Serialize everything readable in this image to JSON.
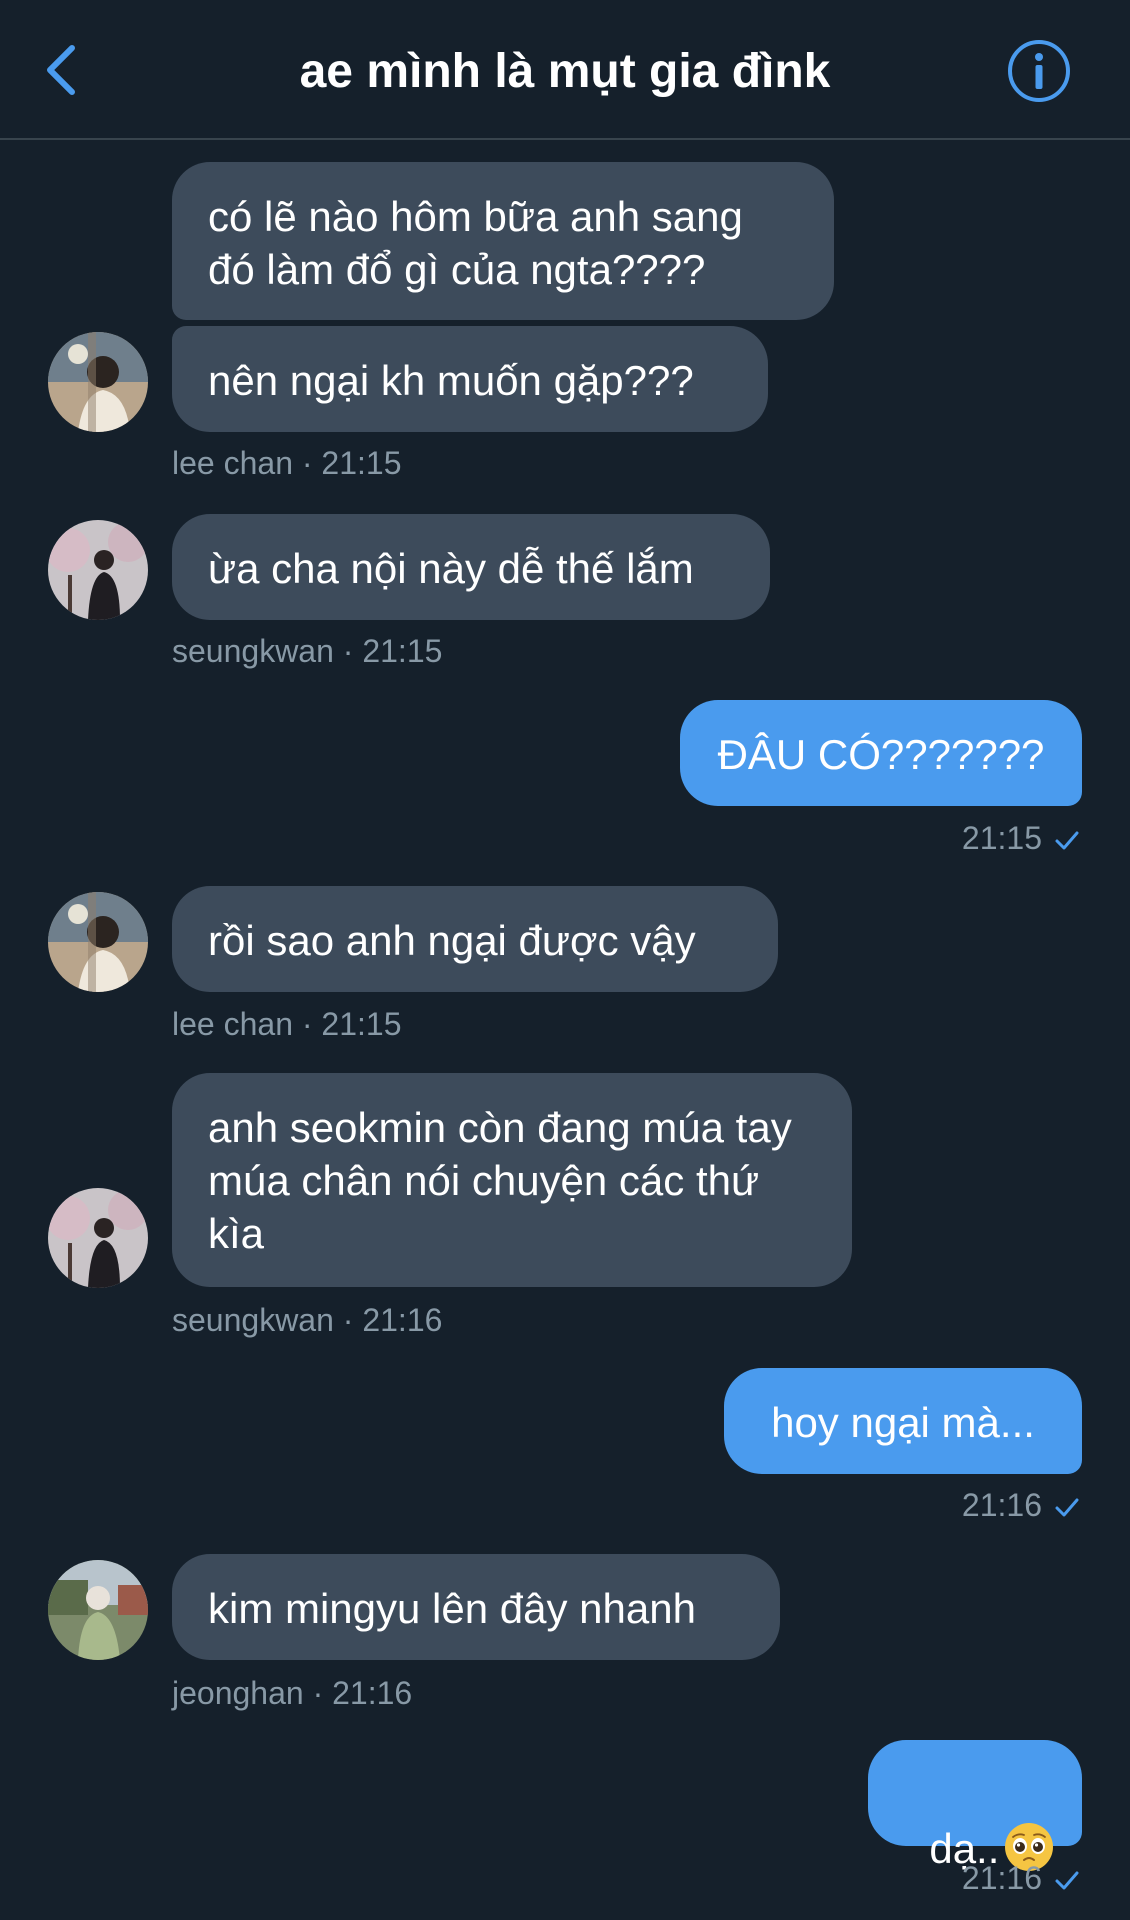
{
  "header": {
    "title": "ae mình là mụt gia đìnk",
    "back_icon": "chevron-left-icon",
    "info_icon": "info-circle-icon",
    "accent": "#4a9bee"
  },
  "colors": {
    "background": "#15202b",
    "incoming_bubble": "#3d4b5b",
    "outgoing_bubble": "#4a9bee",
    "meta_text": "#8899a6"
  },
  "messages": [
    {
      "text": "có lẽ nào hôm bữa anh sang đó làm đổ gì của ngta????"
    },
    {
      "text": "nên ngại kh muốn gặp???",
      "meta": "lee chan · 21:15"
    },
    {
      "text": "ừa cha nội này dễ thế lắm",
      "meta": "seungkwan · 21:15"
    },
    {
      "text": "ĐÂU CÓ???????",
      "meta": "21:15"
    },
    {
      "text": "rồi sao anh ngại được vậy",
      "meta": "lee chan · 21:15"
    },
    {
      "text": "anh seokmin còn đang múa tay múa chân nói chuyện các thứ kìa",
      "meta": "seungkwan · 21:16"
    },
    {
      "text": "hoy ngại mà...",
      "meta": "21:16"
    },
    {
      "text": "kim mingyu lên đây nhanh",
      "meta": "jeonghan · 21:16"
    },
    {
      "text": "dạ..",
      "emoji": "pleading-face-emoji",
      "meta": "21:16"
    }
  ]
}
